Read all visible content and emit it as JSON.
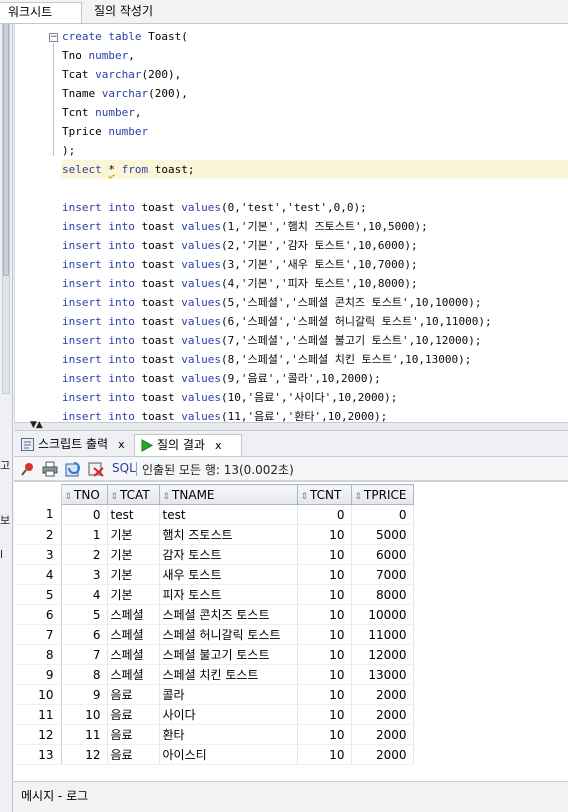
{
  "tabs": {
    "worksheet": "워크시트",
    "query_builder": "질의 작성기"
  },
  "left_strip": {
    "fragments": [
      "고",
      "보",
      "l"
    ]
  },
  "editor": {
    "lines": [
      {
        "kind": "create",
        "a": "create table",
        "b": " Toast("
      },
      {
        "kind": "col",
        "name": "Tno",
        "type": "number",
        "tail": ","
      },
      {
        "kind": "col",
        "name": "Tcat",
        "type": "varchar",
        "args": "(200)",
        "tail": ","
      },
      {
        "kind": "col",
        "name": "Tname",
        "type": "varchar",
        "args": "(200)",
        "tail": ","
      },
      {
        "kind": "col",
        "name": "Tcnt",
        "type": "number",
        "tail": ","
      },
      {
        "kind": "col",
        "name": "Tprice",
        "type": "number",
        "tail": ""
      },
      {
        "kind": "plain",
        "text": ");"
      },
      {
        "kind": "select",
        "a": "select",
        "star": "*",
        "b": "from",
        "c": " toast;"
      },
      {
        "kind": "plain",
        "text": ""
      },
      {
        "kind": "insert",
        "vals": "(0,'test','test',0,0);"
      },
      {
        "kind": "insert",
        "vals": "(1,'기본','햄치 즈토스트',10,5000);"
      },
      {
        "kind": "insert",
        "vals": "(2,'기본','감자 토스트',10,6000);"
      },
      {
        "kind": "insert",
        "vals": "(3,'기본','새우 토스트',10,7000);"
      },
      {
        "kind": "insert",
        "vals": "(4,'기본','피자 토스트',10,8000);"
      },
      {
        "kind": "insert",
        "vals": "(5,'스페셜','스페셜 콘치즈 토스트',10,10000);"
      },
      {
        "kind": "insert",
        "vals": "(6,'스페셜','스페셜 허니갈릭 토스트',10,11000);"
      },
      {
        "kind": "insert",
        "vals": "(7,'스페셜','스페셜 불고기 토스트',10,12000);"
      },
      {
        "kind": "insert",
        "vals": "(8,'스페셜','스페셜 치킨 토스트',10,13000);"
      },
      {
        "kind": "insert",
        "vals": "(9,'음료','콜라',10,2000);"
      },
      {
        "kind": "insert",
        "vals": "(10,'음료','사이다',10,2000);"
      },
      {
        "kind": "insert",
        "vals": "(11,'음료','환타',10,2000);"
      }
    ],
    "insert_kw": [
      "insert",
      "into",
      "toast",
      "values"
    ]
  },
  "result_tabs": {
    "script_output": "스크립트 출력",
    "query_result": "질의 결과",
    "close": "x"
  },
  "toolbar": {
    "sql": "SQL",
    "fetched": "인출된 모든 행: 13(0.002초)"
  },
  "grid": {
    "columns": [
      "TNO",
      "TCAT",
      "TNAME",
      "TCNT",
      "TPRICE"
    ],
    "rows": [
      [
        "1",
        "0",
        "test",
        "test",
        "0",
        "0"
      ],
      [
        "2",
        "1",
        "기본",
        "햄치 즈토스트",
        "10",
        "5000"
      ],
      [
        "3",
        "2",
        "기본",
        "감자 토스트",
        "10",
        "6000"
      ],
      [
        "4",
        "3",
        "기본",
        "새우 토스트",
        "10",
        "7000"
      ],
      [
        "5",
        "4",
        "기본",
        "피자 토스트",
        "10",
        "8000"
      ],
      [
        "6",
        "5",
        "스페셜",
        "스페셜 콘치즈 토스트",
        "10",
        "10000"
      ],
      [
        "7",
        "6",
        "스페셜",
        "스페셜 허니갈릭 토스트",
        "10",
        "11000"
      ],
      [
        "8",
        "7",
        "스페셜",
        "스페셜 불고기 토스트",
        "10",
        "12000"
      ],
      [
        "9",
        "8",
        "스페셜",
        "스페셜 치킨 토스트",
        "10",
        "13000"
      ],
      [
        "10",
        "9",
        "음료",
        "콜라",
        "10",
        "2000"
      ],
      [
        "11",
        "10",
        "음료",
        "사이다",
        "10",
        "2000"
      ],
      [
        "12",
        "11",
        "음료",
        "환타",
        "10",
        "2000"
      ],
      [
        "13",
        "12",
        "음료",
        "아이스티",
        "10",
        "2000"
      ]
    ]
  },
  "messages": {
    "label": "메시지 - 로그"
  }
}
